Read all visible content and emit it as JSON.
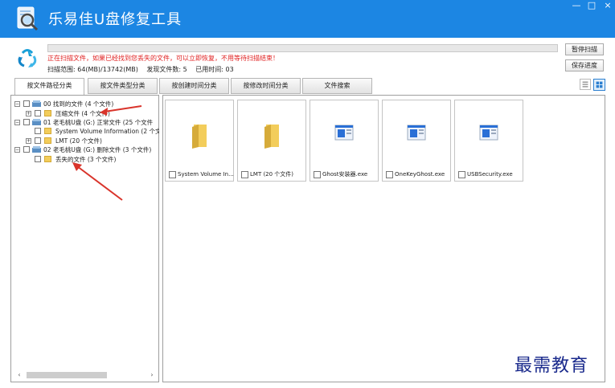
{
  "window": {
    "title": "乐易佳U盘修复工具",
    "min_glyph": "—",
    "max_glyph": "□",
    "close_glyph": "×"
  },
  "status": {
    "message": "正在扫描文件，如果已经找到您丢失的文件，可以立即恢复，不用等待扫描结束！",
    "scan_range": "扫描范围: 64(MB)/13742(MB)",
    "files_found": "发现文件数: 5",
    "time_used": "已用时间: 03",
    "progress_percent": 0
  },
  "buttons": {
    "pause_scan": "暂停扫描",
    "save_progress": "保存进度"
  },
  "tabs": [
    {
      "label": "按文件路径分类",
      "active": true
    },
    {
      "label": "按文件类型分类",
      "active": false
    },
    {
      "label": "按创建时间分类",
      "active": false
    },
    {
      "label": "按修改时间分类",
      "active": false
    },
    {
      "label": "文件搜索",
      "active": false
    }
  ],
  "tree": [
    {
      "label": "00 找到的文件  (4 个文件)",
      "icon": "drive-icon",
      "expander": "−"
    },
    {
      "label": "压缩文件   (4 个文件)",
      "icon": "folder-icon",
      "expander": "+"
    },
    {
      "label": "01 老毛桃U盘 (G:) 正常文件 (25 个文件",
      "icon": "drive-icon",
      "expander": "−"
    },
    {
      "label": "System Volume Information   (2 个文",
      "icon": "folder-icon",
      "expander": ""
    },
    {
      "label": "LMT    (20 个文件)",
      "icon": "folder-icon",
      "expander": "+"
    },
    {
      "label": "02 老毛桃U盘 (G:) 删除文件 (3 个文件)",
      "icon": "drive-icon",
      "expander": "−"
    },
    {
      "label": "丢失的文件    (3 个文件)",
      "icon": "folder-icon",
      "expander": ""
    }
  ],
  "files": [
    {
      "label": "System Volume In...",
      "icon": "folder-icon"
    },
    {
      "label": "LMT  (20 个文件)",
      "icon": "folder-icon"
    },
    {
      "label": "Ghost安装器.exe",
      "icon": "exe-icon"
    },
    {
      "label": "OneKeyGhost.exe",
      "icon": "exe-icon"
    },
    {
      "label": "USBSecurity.exe",
      "icon": "exe-icon"
    }
  ],
  "scroll": {
    "left": "‹",
    "right": "›"
  },
  "watermark": "最需教育",
  "colors": {
    "titlebar": "#1c86e3",
    "status_message": "#e02020",
    "arrow": "#d9342b",
    "folder": "#f3cd5b",
    "exe": "#2a6fd6",
    "watermark": "#1a2a8c"
  }
}
